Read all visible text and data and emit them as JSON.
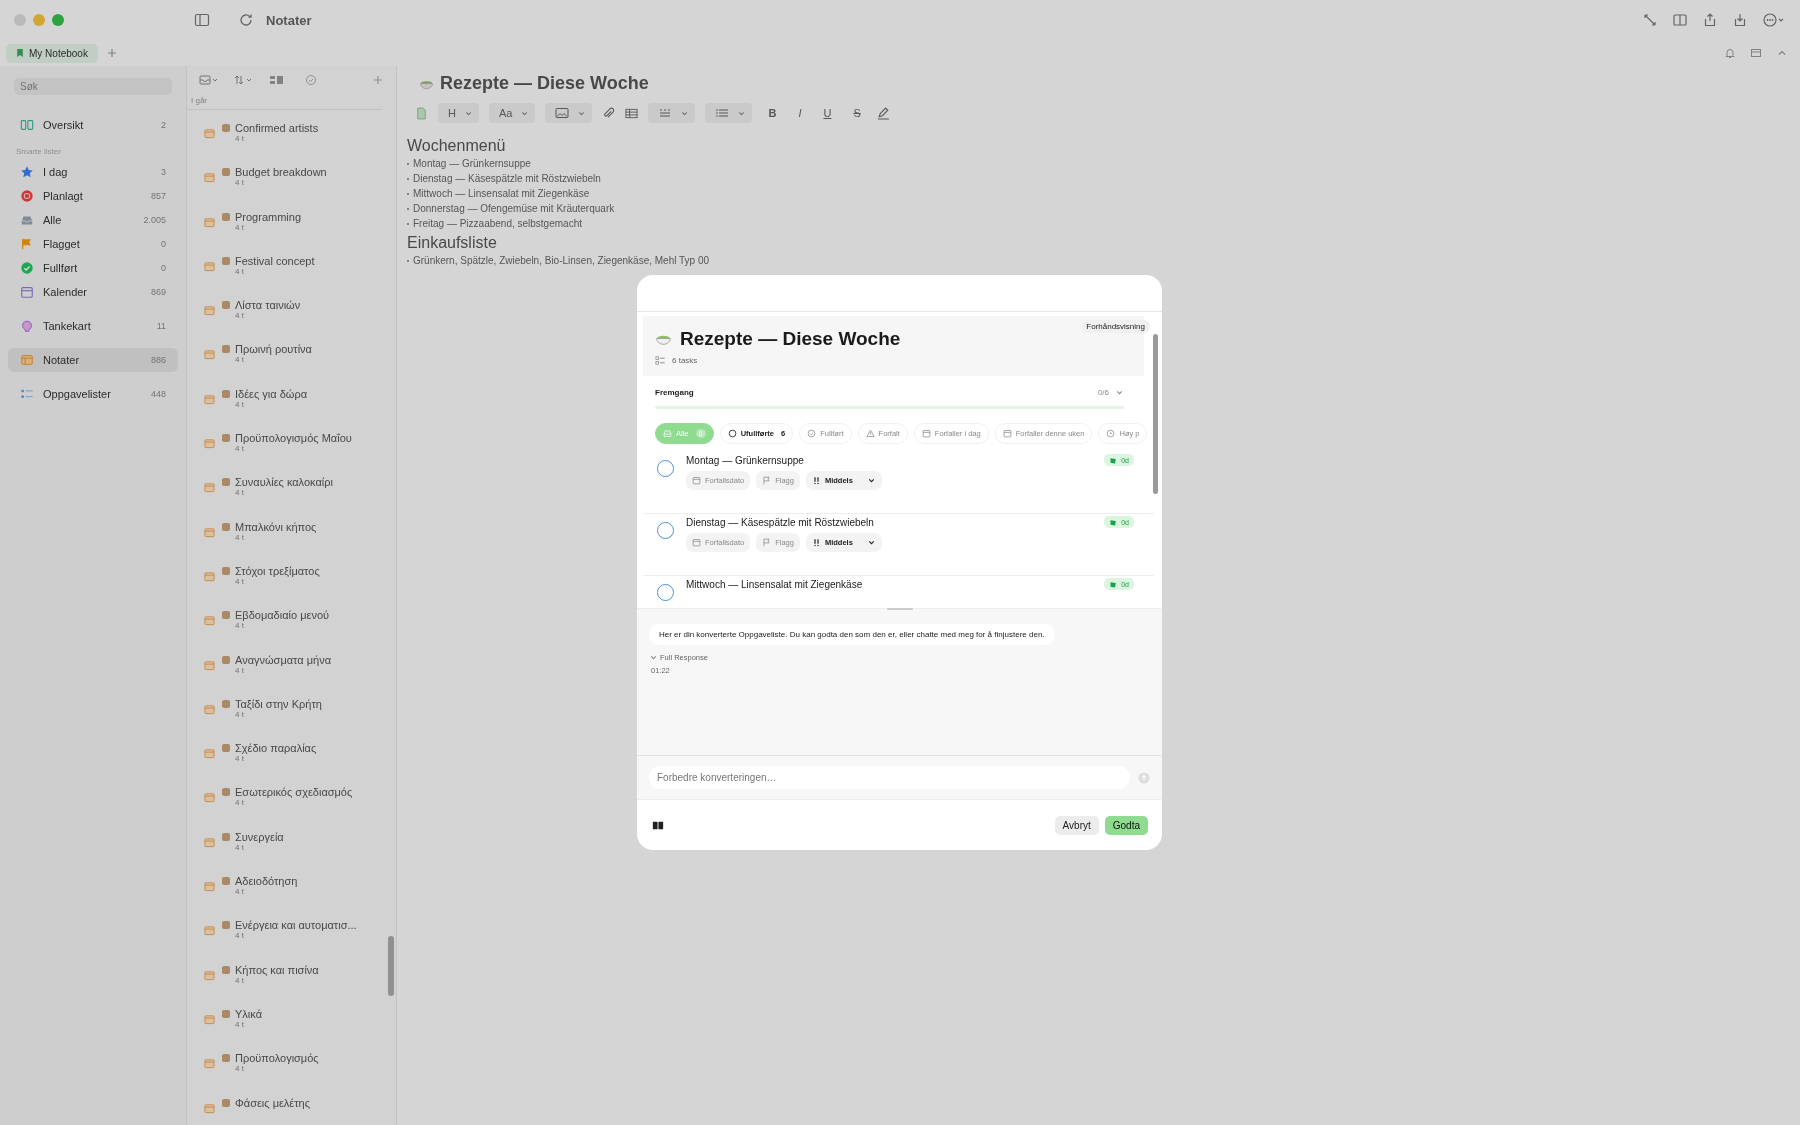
{
  "window": {
    "title": "Notater"
  },
  "tabs": [
    {
      "label": "My Notebook",
      "selected": true
    }
  ],
  "sidebar": {
    "search": {
      "placeholder": "Søk"
    },
    "sections": [
      {
        "items": [
          {
            "label": "Oversikt",
            "count": "2",
            "selected": false
          }
        ]
      },
      {
        "heading": "Smarte lister",
        "items": [
          {
            "label": "I dag",
            "count": "3",
            "selected": false
          },
          {
            "label": "Planlagt",
            "count": "857",
            "selected": false
          },
          {
            "label": "Alle",
            "count": "2.005",
            "selected": false
          },
          {
            "label": "Flagget",
            "count": "0",
            "selected": false
          },
          {
            "label": "Fullført",
            "count": "0",
            "selected": false
          },
          {
            "label": "Kalender",
            "count": "869",
            "selected": false
          }
        ]
      },
      {
        "items": [
          {
            "label": "Tankekart",
            "count": "11",
            "selected": false
          }
        ]
      },
      {
        "items": [
          {
            "label": "Notater",
            "count": "886",
            "selected": true
          }
        ]
      },
      {
        "items": [
          {
            "label": "Oppgavelister",
            "count": "448",
            "selected": false
          }
        ]
      }
    ]
  },
  "notes_list": {
    "group": "I går",
    "notes": [
      {
        "title": "Confirmed artists",
        "time": "4 t"
      },
      {
        "title": "Budget breakdown",
        "time": "4 t"
      },
      {
        "title": "Programming",
        "time": "4 t"
      },
      {
        "title": "Festival concept",
        "time": "4 t"
      },
      {
        "title": "Λίστα ταινιών",
        "time": "4 t"
      },
      {
        "title": "Πρωινή ρουτίνα",
        "time": "4 t"
      },
      {
        "title": "Ιδέες για δώρα",
        "time": "4 t"
      },
      {
        "title": "Προϋπολογισμός Μαΐου",
        "time": "4 t"
      },
      {
        "title": "Συναυλίες καλοκαίρι",
        "time": "4 t"
      },
      {
        "title": "Μπαλκόνι κήπος",
        "time": "4 t"
      },
      {
        "title": "Στόχοι τρεξίματος",
        "time": "4 t"
      },
      {
        "title": "Εβδομαδιαίο μενού",
        "time": "4 t"
      },
      {
        "title": "Αναγνώσματα μήνα",
        "time": "4 t"
      },
      {
        "title": "Ταξίδι στην Κρήτη",
        "time": "4 t"
      },
      {
        "title": "Σχέδιο παραλίας",
        "time": "4 t"
      },
      {
        "title": "Εσωτερικός σχεδιασμός",
        "time": "4 t"
      },
      {
        "title": "Συνεργεία",
        "time": "4 t"
      },
      {
        "title": "Αδειοδότηση",
        "time": "4 t"
      },
      {
        "title": "Ενέργεια και αυτοματισ...",
        "time": "4 t"
      },
      {
        "title": "Κήπος και πισίνα",
        "time": "4 t"
      },
      {
        "title": "Υλικά",
        "time": "4 t"
      },
      {
        "title": "Προϋπολογισμός",
        "time": "4 t"
      },
      {
        "title": "Φάσεις μελέτης"
      }
    ]
  },
  "editor": {
    "title": "Rezepte — Diese Woche",
    "toolbar": {
      "heading_button": "H",
      "font_button": "Aa",
      "format_buttons": [
        "B",
        "I",
        "U",
        "S"
      ]
    },
    "content": [
      {
        "kind": "heading",
        "text": "Wochenmenü"
      },
      {
        "kind": "bullet",
        "text": "Montag — Grünkernsuppe"
      },
      {
        "kind": "bullet",
        "text": "Dienstag — Käsespätzle mit Röstzwiebeln"
      },
      {
        "kind": "bullet",
        "text": "Mittwoch — Linsensalat mit Ziegenkäse"
      },
      {
        "kind": "bullet",
        "text": "Donnerstag — Ofengemüse mit Kräuterquark"
      },
      {
        "kind": "bullet",
        "text": "Freitag — Pizzaabend, selbstgemacht"
      },
      {
        "kind": "heading",
        "text": "Einkaufsliste"
      },
      {
        "kind": "bullet",
        "text": "Grünkern, Spätzle, Zwiebeln, Bio-Linsen, Ziegenkäse, Mehl Typ 00"
      }
    ]
  },
  "dialog": {
    "badge": "Forhåndsvisning",
    "title": "Rezepte — Diese Woche",
    "task_count": "6 tasks",
    "progress": {
      "label": "Fremgang",
      "reading": "0/6",
      "level": 0
    },
    "filters": [
      {
        "label": "Alle",
        "count": "6",
        "selected": true
      },
      {
        "label": "Ufullførte",
        "count": "6",
        "selected": false
      },
      {
        "label": "Fullført",
        "selected": false
      },
      {
        "label": "Forfalt",
        "selected": false
      },
      {
        "label": "Forfaller i dag",
        "selected": false
      },
      {
        "label": "Forfaller denne uken",
        "selected": false
      },
      {
        "label": "Høy p",
        "selected": false
      }
    ],
    "tasks": [
      {
        "title": "Montag — Grünkernsuppe",
        "done": false,
        "due": "Forfallsdato",
        "flag": "Flagg",
        "priority": "Middels",
        "badge": "0d"
      },
      {
        "title": "Dienstag — Käsespätzle mit Röstzwiebeln",
        "done": false,
        "due": "Forfallsdato",
        "flag": "Flagg",
        "priority": "Middels",
        "badge": "0d"
      },
      {
        "title": "Mittwoch — Linsensalat mit Ziegenkäse",
        "done": false,
        "badge": "0d"
      }
    ],
    "chat": {
      "message": "Her er din konverterte Oppgaveliste. Du kan godta den som den er, eller chatte med meg for å finjustere den.",
      "expander": "Full Response",
      "time": "01:22"
    },
    "input": {
      "placeholder": "Forbedre konverteringen…"
    },
    "buttons": {
      "cancel": "Avbryt",
      "accept": "Godta"
    }
  }
}
